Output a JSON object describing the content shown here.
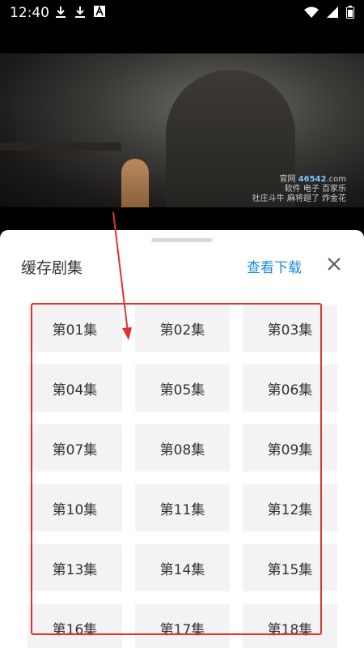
{
  "status_bar": {
    "time": "12:40",
    "icons_left": [
      "download-icon",
      "download-icon",
      "a-badge-icon"
    ],
    "icons_right": [
      "wifi-icon",
      "signal-icon",
      "battery-icon"
    ]
  },
  "video": {
    "watermark_line1": "官网",
    "watermark_num": "46542",
    "watermark_dot": ".com",
    "watermark_line2": "软件 电子 百家乐",
    "watermark_line3": "社庄斗牛 麻将翅了 炸金花"
  },
  "sheet": {
    "title": "缓存剧集",
    "view_downloads_label": "查看下载",
    "close_icon": "close-icon",
    "episodes": [
      "第01集",
      "第02集",
      "第03集",
      "第04集",
      "第05集",
      "第06集",
      "第07集",
      "第08集",
      "第09集",
      "第10集",
      "第11集",
      "第12集",
      "第13集",
      "第14集",
      "第15集",
      "第16集",
      "第17集",
      "第18集"
    ]
  },
  "annotation": {
    "color": "#e53030"
  }
}
